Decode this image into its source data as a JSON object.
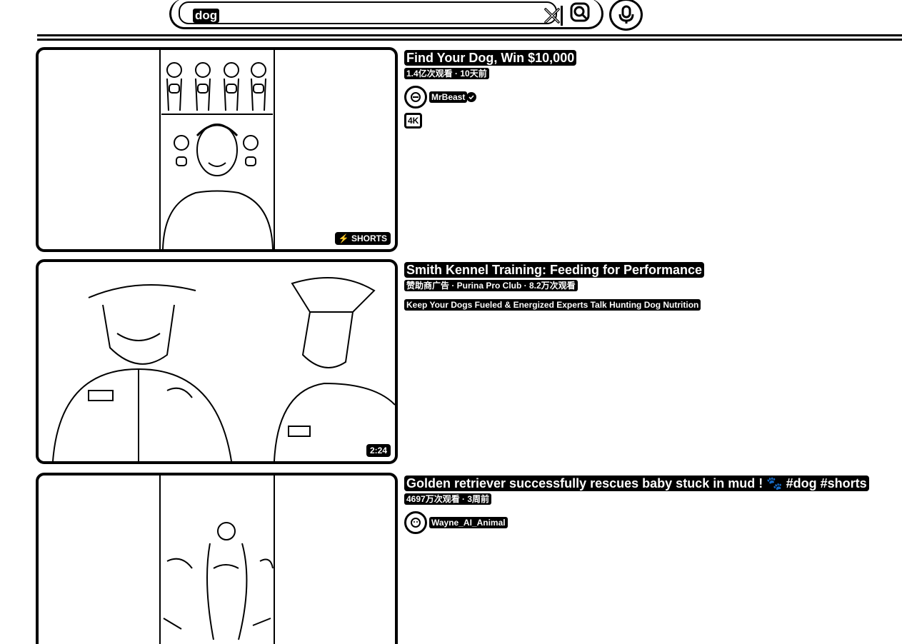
{
  "search": {
    "query": "dog",
    "clear_icon": "close-icon",
    "search_icon": "search-icon",
    "mic_icon": "microphone-icon"
  },
  "results": [
    {
      "title": "Find Your Dog, Win $10,000",
      "meta": "1.4亿次观看 · 10天前",
      "channel": "MrBeast",
      "verified": true,
      "quality_badge": "4K",
      "thumb_badge": "SHORTS",
      "thumb_badge_icon": "shorts-icon"
    },
    {
      "title": "Smith Kennel Training: Feeding for Performance",
      "meta": "赞助商广告 · Purina Pro Club · 8.2万次观看",
      "description": "Keep Your Dogs Fueled & Energized Experts Talk Hunting Dog Nutrition",
      "duration": "2:24"
    },
    {
      "title": "Golden retriever successfully rescues baby stuck in mud ! 🐾 #dog #shorts",
      "meta": "4697万次观看 · 3周前",
      "channel": "Wayne_AI_Animal"
    }
  ]
}
